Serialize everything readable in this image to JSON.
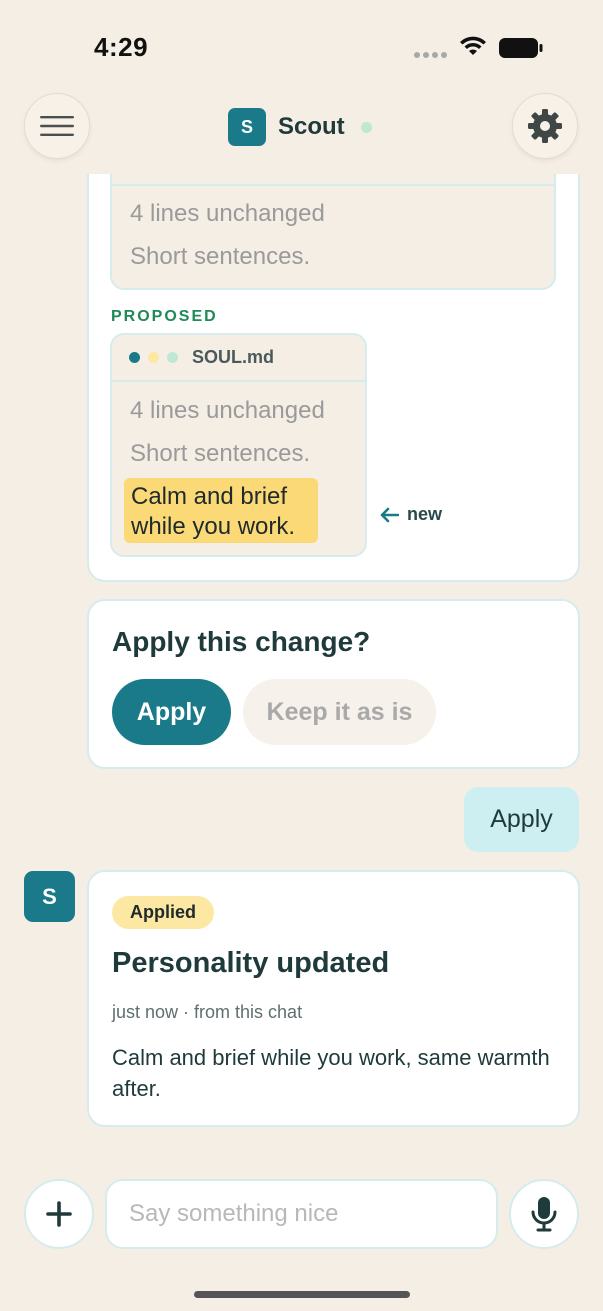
{
  "status_bar": {
    "time": "4:29"
  },
  "header": {
    "avatar_letter": "S",
    "name": "Scout"
  },
  "diff": {
    "current_lines": [
      "4 lines unchanged",
      "Short sentences."
    ],
    "proposed_label": "PROPOSED",
    "file_name": "SOUL.md",
    "proposed_lines": [
      "4 lines unchanged",
      "Short sentences."
    ],
    "new_line": "Calm and brief while you work.",
    "new_note": "new",
    "window_dot_colors": [
      "#1b7a8a",
      "#fde8a3",
      "#bfe8d4"
    ]
  },
  "confirm": {
    "question": "Apply this change?",
    "apply_label": "Apply",
    "keep_label": "Keep it as is"
  },
  "user_message": "Apply",
  "agent": {
    "avatar_letter": "S",
    "badge": "Applied",
    "title": "Personality updated",
    "meta": "just now · from this chat",
    "body": "Calm and brief while you work, same warmth after."
  },
  "composer": {
    "placeholder": "Say something nice"
  },
  "colors": {
    "accent": "#1b7a8a",
    "background": "#f5eee5",
    "highlight": "#fbd977",
    "proposed_green": "#1e8a57"
  }
}
